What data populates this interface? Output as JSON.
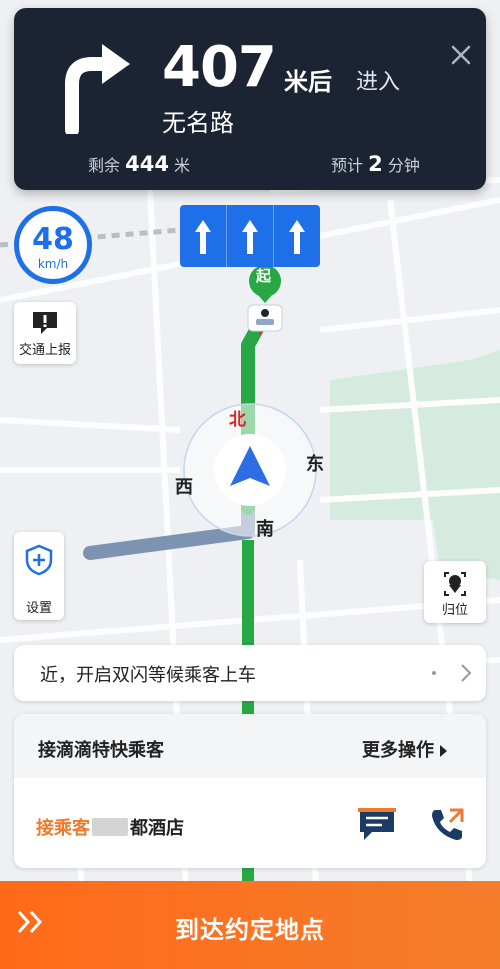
{
  "navigation": {
    "distance_number": "407",
    "distance_unit": "米后",
    "action": "进入",
    "road_name": "无名路",
    "remaining_label": "剩余",
    "remaining_value": "444",
    "remaining_unit": "米",
    "eta_label": "预计",
    "eta_value": "2",
    "eta_unit": "分钟",
    "turn_icon": "turn-right-icon",
    "close_icon": "close-icon"
  },
  "lanes": [
    {
      "direction": "straight",
      "icon": "straight-arrow-icon"
    },
    {
      "direction": "straight",
      "icon": "straight-arrow-icon"
    },
    {
      "direction": "straight",
      "icon": "straight-arrow-icon"
    }
  ],
  "speed": {
    "value": "48",
    "unit": "km/h"
  },
  "map": {
    "start_marker": "起",
    "compass": {
      "north": "北",
      "east": "东",
      "south": "南",
      "west": "西"
    },
    "route_color": "#27a845",
    "passed_route_color": "#7d93b2",
    "accent": "#1f6fe8"
  },
  "buttons": {
    "traffic_report": "交通上报",
    "settings": "设置",
    "locate": "归位"
  },
  "notice": {
    "text": "近，开启双闪等候乘客上车"
  },
  "order": {
    "title": "接滴滴特快乘客",
    "more_label": "更多操作",
    "pickup_label": "接乘客",
    "pickup_place": "都酒店",
    "accent": "#f07a2c"
  },
  "arrive_button": {
    "label": "到达约定地点"
  }
}
